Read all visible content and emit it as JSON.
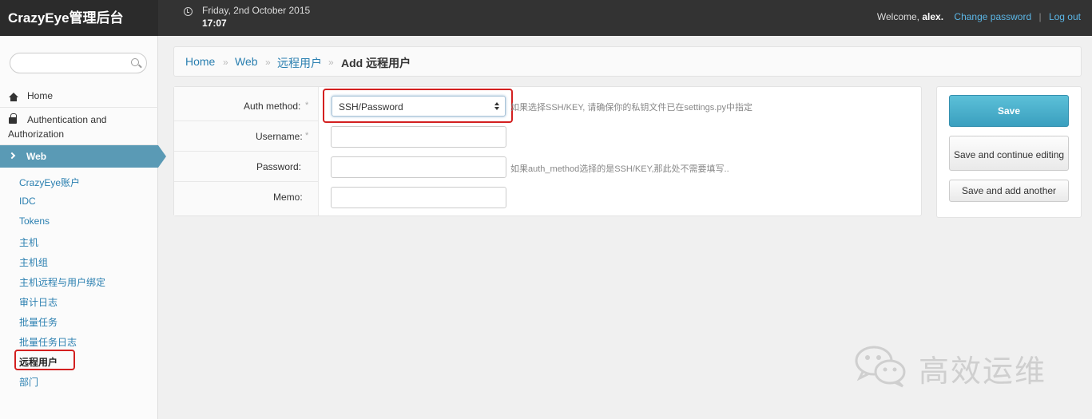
{
  "header": {
    "brand": "CrazyEye管理后台",
    "date": "Friday, 2nd October 2015",
    "time": "17:07",
    "welcome_prefix": "Welcome, ",
    "username": "alex.",
    "change_password": "Change password",
    "separator": "|",
    "logout": "Log out"
  },
  "sidebar": {
    "search_placeholder": "",
    "home": "Home",
    "auth": "Authentication and Authorization",
    "web": "Web",
    "sub_items": [
      "CrazyEye账户",
      "IDC",
      "Tokens",
      "主机",
      "主机组",
      "主机远程与用户绑定",
      "审计日志",
      "批量任务",
      "批量任务日志",
      "远程用户",
      "部门"
    ],
    "active_sub": "远程用户"
  },
  "breadcrumb": {
    "items": [
      "Home",
      "Web",
      "远程用户"
    ],
    "separator": "»",
    "current": "Add 远程用户"
  },
  "form": {
    "auth_method": {
      "label": "Auth method:",
      "required": "*",
      "value": "SSH/Password",
      "help": "如果选择SSH/KEY, 请确保你的私钥文件已在settings.py中指定"
    },
    "username": {
      "label": "Username:",
      "required": "*",
      "value": ""
    },
    "password": {
      "label": "Password:",
      "value": "",
      "help": "如果auth_method选择的是SSH/KEY,那此处不需要填写.."
    },
    "memo": {
      "label": "Memo:",
      "value": ""
    }
  },
  "actions": {
    "save": "Save",
    "save_continue": "Save and continue editing",
    "save_another": "Save and add another"
  },
  "watermark": {
    "text": "高效运维"
  },
  "colors": {
    "topbar": "#333333",
    "accent": "#5a9ab5",
    "link": "#2a7fb0",
    "highlight": "#d32020",
    "save_button": "#3a9fbf"
  }
}
